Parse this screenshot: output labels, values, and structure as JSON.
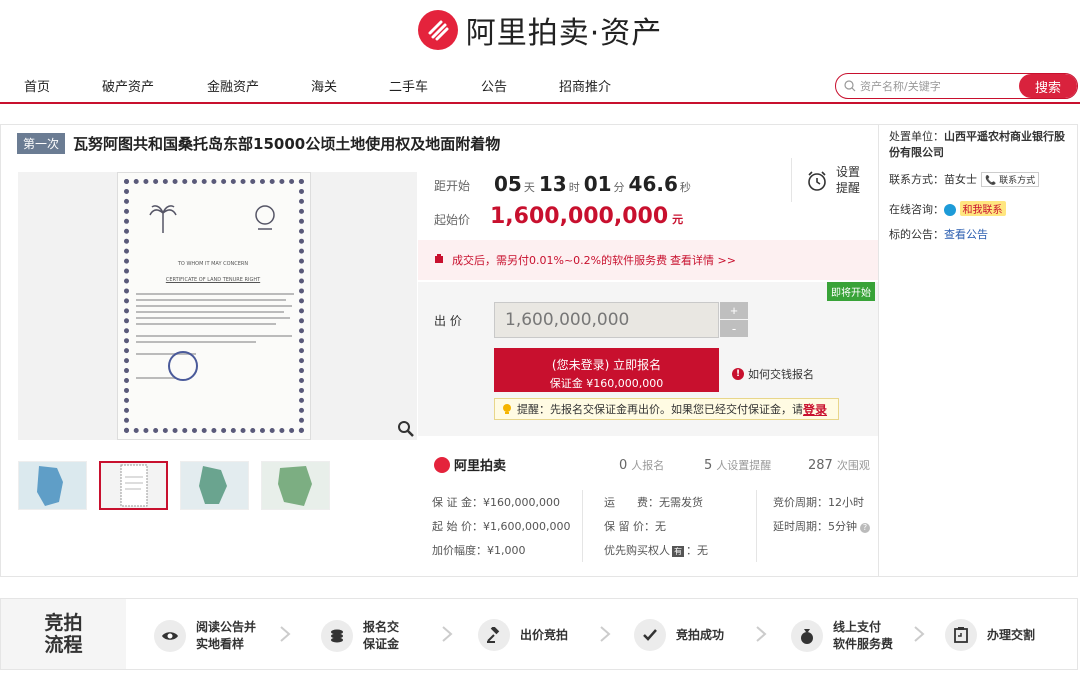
{
  "header": {
    "logo_text": "阿里拍卖·资产"
  },
  "nav": {
    "items": [
      "首页",
      "破产资产",
      "金融资产",
      "海关",
      "二手车",
      "公告",
      "招商推介"
    ],
    "search_placeholder": "资产名称/关键字",
    "search_button": "搜索"
  },
  "auction": {
    "round_tag": "第一次",
    "title": "瓦努阿图共和国桑托岛东部15000公顷土地使用权及地面附着物",
    "countdown_label": "距开始",
    "countdown": {
      "days": "05",
      "days_unit": "天",
      "hours": "13",
      "hours_unit": "时",
      "minutes": "01",
      "minutes_unit": "分",
      "seconds": "46.6",
      "seconds_unit": "秒"
    },
    "remind_label": "设置提醒",
    "start_price_label": "起始价",
    "start_price": "1,600,000,000",
    "start_price_unit": "元",
    "fee_text": "成交后，需另付0.01%~0.2%的软件服务费",
    "fee_link": "查看详情 >>",
    "status_badge": "即将开始",
    "bid_label": "出 价",
    "bid_value": "1,600,000,000",
    "step_plus": "+",
    "step_minus": "-",
    "signup_line1": "(您未登录) 立即报名",
    "signup_line2": "保证金 ¥160,000,000",
    "howto_label": "如何交钱报名",
    "howto_icon": "!",
    "tip_text": "提醒：先报名交保证金再出价。如果您已经交付保证金，请",
    "tip_login": "登录"
  },
  "document": {
    "heading1": "TO WHOM IT MAY CONCERN",
    "heading2": "CERTIFICATE OF LAND TENURE RIGHT"
  },
  "stats": {
    "logo": "阿里拍卖",
    "signups": "0",
    "signups_label": "人报名",
    "reminders": "5",
    "reminders_label": "人设置提醒",
    "views": "287",
    "views_label": "次围观"
  },
  "details": {
    "deposit": "保 证 金：¥160,000,000",
    "start_price": "起 始 价：¥1,600,000,000",
    "increment": "加价幅度：¥1,000",
    "shipping": "运　　费：无需发货",
    "reserve": "保 留 价：无",
    "priority_prefix": "优先购买权人",
    "priority_badge": "有",
    "priority_suffix": "：无",
    "period": "竞价周期：12小时",
    "delay": "延时周期：5分钟",
    "help": "?"
  },
  "seller": {
    "unit_label": "处置单位：",
    "unit_value": "山西平遥农村商业银行股份有限公司",
    "contact_label": "联系方式：",
    "contact_name": "苗女士",
    "contact_button": "📞 联系方式",
    "chat_label": "在线咨询：",
    "chat_badge": "和我联系",
    "notice_label": "标的公告：",
    "notice_link": "查看公告"
  },
  "process": {
    "title_line1": "竞拍",
    "title_line2": "流程",
    "steps": [
      {
        "l1": "阅读公告并",
        "l2": "实地看样"
      },
      {
        "l1": "报名交",
        "l2": "保证金"
      },
      {
        "l1": "出价竞拍",
        "l2": ""
      },
      {
        "l1": "竞拍成功",
        "l2": ""
      },
      {
        "l1": "线上支付",
        "l2": "软件服务费"
      },
      {
        "l1": "办理交割",
        "l2": ""
      }
    ]
  },
  "colors": {
    "brand_red": "#c8102e",
    "badge_green": "#38a338",
    "tag_gray": "#6b7c93"
  }
}
